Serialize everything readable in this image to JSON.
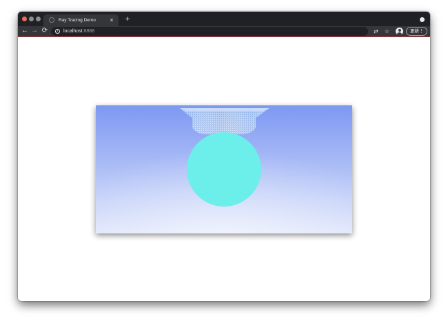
{
  "browser": {
    "tab": {
      "title": "Ray Tracing Demo",
      "close_glyph": "×",
      "favicon_icon": "globe-icon"
    },
    "new_tab_glyph": "+",
    "nav": {
      "back_glyph": "←",
      "forward_glyph": "→",
      "reload_glyph": "⟳"
    },
    "address": {
      "host": "localhost",
      "port": ":8888",
      "info_glyph": "i"
    },
    "toolbar_icons": {
      "translate_glyph": "⇄",
      "star_glyph": "☆",
      "menu_glyph": "⋮"
    },
    "update_label": "更新"
  },
  "colors": {
    "titlebar": "#202124",
    "toolbar": "#35363a",
    "accent_line": "#c0343c",
    "traffic_close": "#ec6a5e",
    "traffic_min": "#8e8e8e",
    "traffic_max": "#8e8e8e",
    "sky_top": "#7d98f2",
    "sky_bottom": "#dfe6fb",
    "sphere": "#6ceeea",
    "ground_sphere": "#a8c6ee"
  },
  "scene": {
    "description_icon": "ray-traced-scene"
  }
}
